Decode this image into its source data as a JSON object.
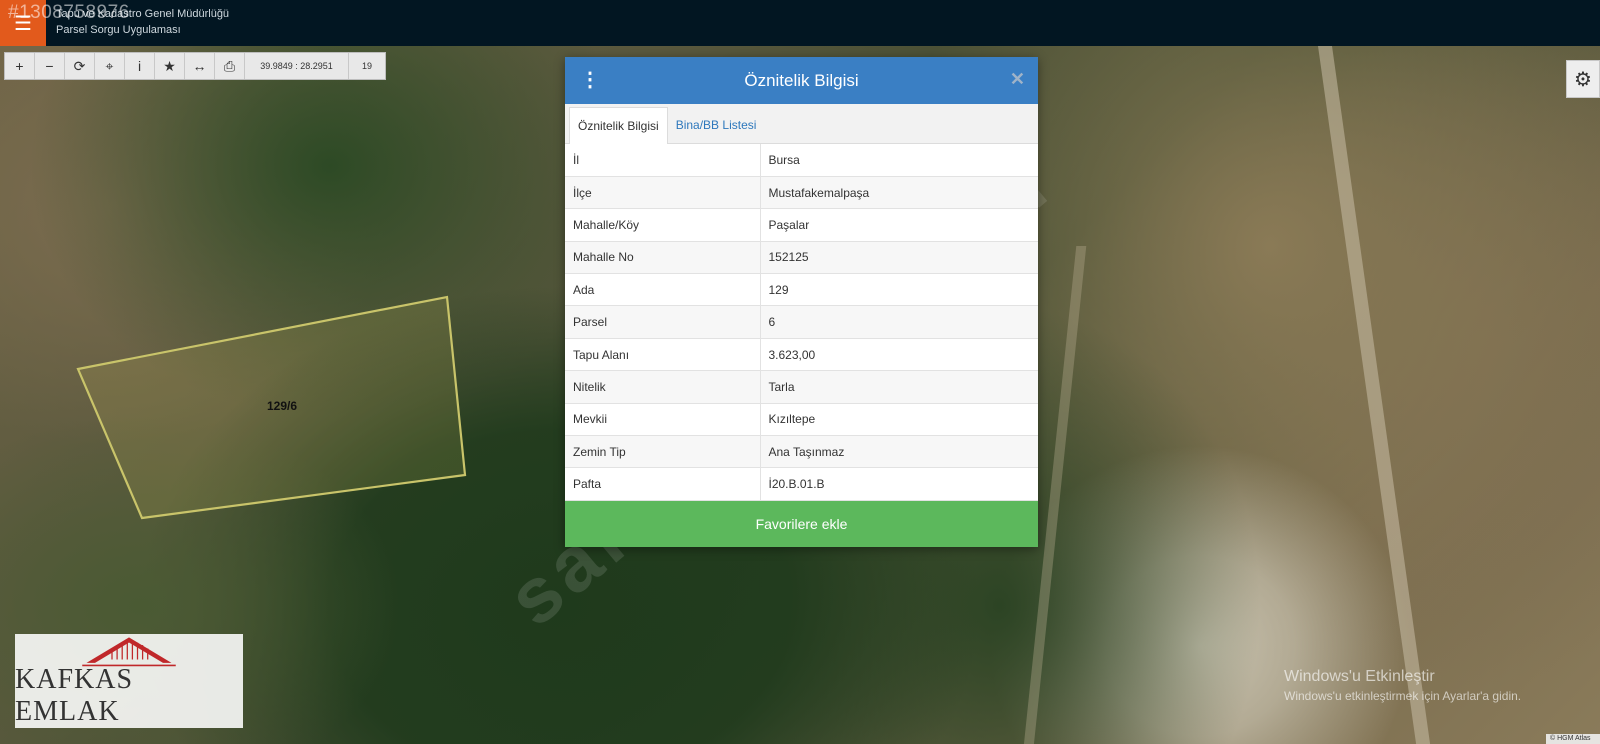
{
  "header": {
    "overlay_id": "#1308758976",
    "org_name": "Tapu ve Kadastro Genel Müdürlüğü",
    "app_name": "Parsel Sorgu Uygulaması"
  },
  "toolbar": {
    "tools": [
      {
        "name": "zoom-in",
        "glyph": "+"
      },
      {
        "name": "zoom-out",
        "glyph": "−"
      },
      {
        "name": "refresh",
        "glyph": "⟳"
      },
      {
        "name": "locate",
        "glyph": "⌖"
      },
      {
        "name": "info",
        "glyph": "i"
      },
      {
        "name": "favorite",
        "glyph": "★"
      },
      {
        "name": "measure",
        "glyph": "↔"
      },
      {
        "name": "print",
        "glyph": "⎙"
      }
    ],
    "coordinates": "39.9849 : 28.2951",
    "zoom_level": "19"
  },
  "map": {
    "parcel_label": "129/6",
    "watermark": "sahibinden.com"
  },
  "modal": {
    "title": "Öznitelik Bilgisi",
    "tabs": [
      {
        "label": "Öznitelik Bilgisi",
        "active": true
      },
      {
        "label": "Bina/BB Listesi",
        "active": false
      }
    ],
    "rows": [
      {
        "key": "İl",
        "value": "Bursa"
      },
      {
        "key": "İlçe",
        "value": "Mustafakemalpaşa"
      },
      {
        "key": "Mahalle/Köy",
        "value": "Paşalar"
      },
      {
        "key": "Mahalle No",
        "value": "152125"
      },
      {
        "key": "Ada",
        "value": "129"
      },
      {
        "key": "Parsel",
        "value": "6"
      },
      {
        "key": "Tapu Alanı",
        "value": "3.623,00"
      },
      {
        "key": "Nitelik",
        "value": "Tarla"
      },
      {
        "key": "Mevkii",
        "value": "Kızıltepe"
      },
      {
        "key": "Zemin Tip",
        "value": "Ana Taşınmaz"
      },
      {
        "key": "Pafta",
        "value": "İ20.B.01.B"
      }
    ],
    "favorite_label": "Favorilere ekle"
  },
  "logo": {
    "text": "KAFKAS EMLAK"
  },
  "windows_notice": {
    "title": "Windows'u Etkinleştir",
    "subtitle": "Windows'u etkinleştirmek için Ayarlar'a gidin."
  },
  "attribution": "© HGM Atlas",
  "colors": {
    "topbar": "#021622",
    "menu_accent": "#e25a1c",
    "modal_header": "#3a7fc4",
    "favorite_button": "#5cb85c",
    "tab_link": "#2e78bc",
    "parcel_outline": "#c9c46a",
    "logo_red": "#c0282a"
  },
  "icons": {
    "menu": "hamburger-icon",
    "settings": "gear-icon",
    "modal_menu": "kebab-menu-icon",
    "close": "close-icon"
  }
}
